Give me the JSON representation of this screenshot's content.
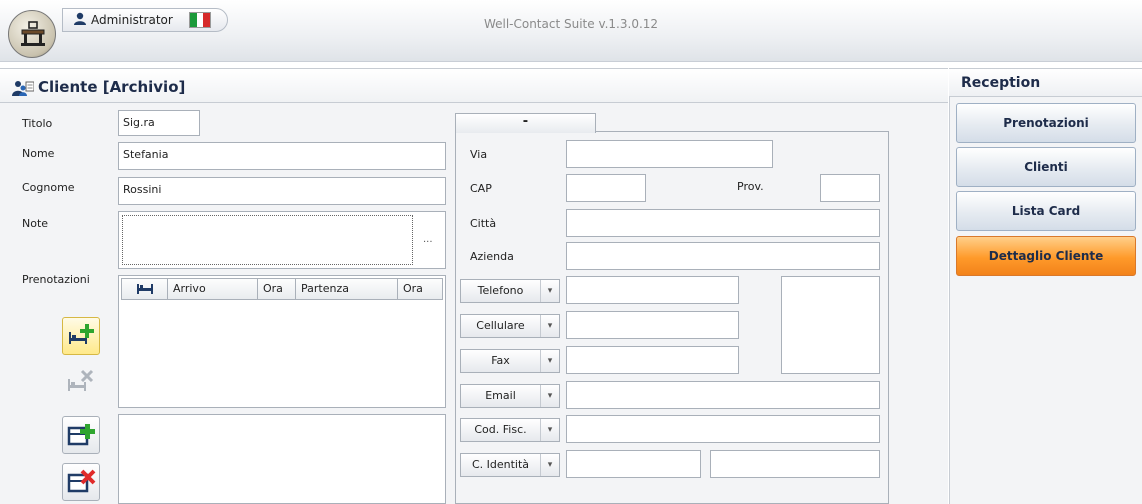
{
  "header": {
    "user_name": "Administrator",
    "app_title": "Well-Contact Suite v.1.3.0.12"
  },
  "main": {
    "title": "Cliente [Archivio]",
    "fields": {
      "titolo_label": "Titolo",
      "titolo_value": "Sig.ra",
      "nome_label": "Nome",
      "nome_value": "Stefania",
      "cognome_label": "Cognome",
      "cognome_value": "Rossini",
      "note_label": "Note",
      "note_value": "",
      "note_more": "...",
      "prenotazioni_label": "Prenotazioni"
    },
    "reservations_table": {
      "columns": [
        "Arrivo",
        "Ora",
        "Partenza",
        "Ora"
      ],
      "rows": []
    },
    "address_tab": "-",
    "address": {
      "via_label": "Via",
      "via_value": "",
      "cap_label": "CAP",
      "cap_value": "",
      "prov_label": "Prov.",
      "prov_value": "",
      "citta_label": "Città",
      "citta_value": "",
      "azienda_label": "Azienda",
      "azienda_value": ""
    },
    "contacts": [
      {
        "label": "Telefono",
        "value": ""
      },
      {
        "label": "Cellulare",
        "value": ""
      },
      {
        "label": "Fax",
        "value": ""
      },
      {
        "label": "Email",
        "value": ""
      },
      {
        "label": "Cod. Fisc.",
        "value": ""
      },
      {
        "label": "C. Identità",
        "value": ""
      }
    ]
  },
  "sidebar": {
    "title": "Reception",
    "items": [
      {
        "label": "Prenotazioni",
        "active": false
      },
      {
        "label": "Clienti",
        "active": false
      },
      {
        "label": "Lista Card",
        "active": false
      },
      {
        "label": "Dettaglio Cliente",
        "active": true
      }
    ]
  },
  "colors": {
    "accent": "#ff9a2a",
    "title": "#1e2c4a"
  },
  "icons": [
    "app-logo-icon",
    "user-icon",
    "italy-flag-icon",
    "client-card-icon",
    "bed-icon",
    "add-reservation-icon",
    "remove-reservation-icon",
    "add-card-icon",
    "remove-card-icon",
    "dropdown-arrow-icon"
  ]
}
